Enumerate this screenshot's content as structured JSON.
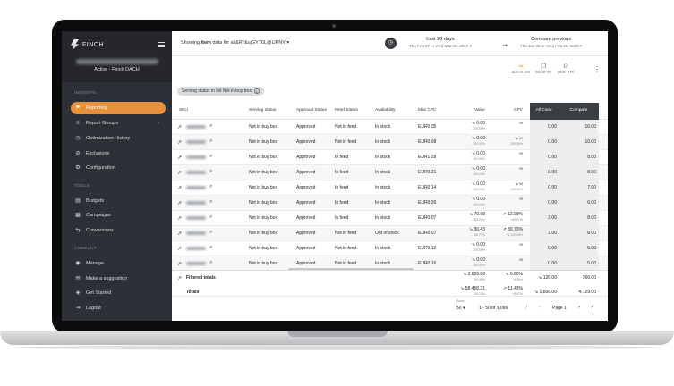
{
  "brand": {
    "name": "FINCH"
  },
  "account": {
    "name": "Active - Finch DACH"
  },
  "sidebar": {
    "sections": [
      "INSIGHTS",
      "TOOLS",
      "ACCOUNT"
    ],
    "items": [
      {
        "label": "Reporting",
        "icon": "reporting-icon",
        "glyph": "⚑",
        "active": true
      },
      {
        "label": "Report Groups",
        "icon": "report-groups-icon",
        "glyph": "≡",
        "chevron": "›"
      },
      {
        "label": "Optimization History",
        "icon": "history-icon",
        "glyph": "◷"
      },
      {
        "label": "Exclusions",
        "icon": "exclusions-icon",
        "glyph": "⊘"
      },
      {
        "label": "Configuration",
        "icon": "gear-icon",
        "glyph": "⚙"
      },
      {
        "label": "Budgets",
        "icon": "budgets-icon",
        "glyph": "▤"
      },
      {
        "label": "Campaigns",
        "icon": "campaigns-icon",
        "glyph": "▦"
      },
      {
        "label": "Conversions",
        "icon": "conversions-icon",
        "glyph": "⇆"
      },
      {
        "label": "Manage",
        "icon": "manage-icon",
        "glyph": "◉"
      },
      {
        "label": "Make a suggestion",
        "icon": "suggestion-icon",
        "glyph": "✉"
      },
      {
        "label": "Get Started",
        "icon": "get-started-icon",
        "glyph": "◈"
      },
      {
        "label": "Logout",
        "icon": "logout-icon",
        "glyph": "⇥"
      }
    ]
  },
  "topbar": {
    "showing_prefix": "Showing",
    "showing_bold": "item",
    "showing_suffix": "data for ali&R*&ujGY76L@UPNY",
    "dropdown_glyph": "▾",
    "date_range": {
      "title": "Last 28 days",
      "dates": "Thu Feb 27 to Wed Mar 25, 2020"
    },
    "compare_range": {
      "title": "Compare previous",
      "dates": "Thu Jan 30 to Wed Feb 26, 2020"
    },
    "calendar_glyph": "◷",
    "compare_glyph": "⇝"
  },
  "tools": [
    {
      "label": "ADD FILTER",
      "icon": "filter-icon",
      "glyph": "≂"
    },
    {
      "label": "GROUP BY",
      "icon": "group-by-icon",
      "glyph": "❐"
    },
    {
      "label": "VIEW TYPE",
      "icon": "view-type-icon",
      "glyph": "⊙"
    }
  ],
  "filter_chip": {
    "label": "Serving status in list Not in buy box",
    "close": "×"
  },
  "table": {
    "headers": [
      "SKU",
      "Serving status",
      "Approval Status",
      "Feed Status",
      "Availability",
      "Max CPC",
      "Value",
      "CPV",
      "All Conv.",
      "Compare"
    ],
    "rows": [
      {
        "serving": "Not in buy box",
        "approval": "Approved",
        "feed": "Not in feed",
        "avail": "In stock",
        "cpc": "EUR0.05",
        "value": "↘ 0.00",
        "value_s": "-100.00%",
        "cpv": "∞",
        "cpv_s": "",
        "conv": "0.00",
        "compare": "16.00"
      },
      {
        "serving": "Not in buy box",
        "approval": "Approved",
        "feed": "Not in feed",
        "avail": "In stock",
        "cpc": "EUR0.08",
        "value": "↘ 0.00",
        "value_s": "-100.00%",
        "cpv": "↘ ∞",
        "cpv_s": "-100.00%",
        "conv": "0.00",
        "compare": "10.00"
      },
      {
        "serving": "Not in buy box",
        "approval": "Approved",
        "feed": "In feed",
        "avail": "In stock",
        "cpc": "EUR1.28",
        "value": "↘ 0.00",
        "value_s": "-100.00%",
        "cpv": "∞",
        "cpv_s": "",
        "conv": "0.00",
        "compare": "8.00"
      },
      {
        "serving": "Not in buy box",
        "approval": "Approved",
        "feed": "In feed",
        "avail": "In stock",
        "cpc": "EUR0.21",
        "value": "↘ 0.00",
        "value_s": "-100.00%",
        "cpv": "∞",
        "cpv_s": "",
        "conv": "0.00",
        "compare": "8.00"
      },
      {
        "serving": "Not in buy box",
        "approval": "Approved",
        "feed": "In feed",
        "avail": "In stock",
        "cpc": "EUR0.14",
        "value": "↘ 0.00",
        "value_s": "-100.00%",
        "cpv": "↘ ∞",
        "cpv_s": "-100.00%",
        "conv": "0.00",
        "compare": "7.00"
      },
      {
        "serving": "Not in buy box",
        "approval": "Approved",
        "feed": "In feed",
        "avail": "In stock",
        "cpc": "EUR0.26",
        "value": "↘ 0.00",
        "value_s": "-100.00%",
        "cpv": "∞",
        "cpv_s": "",
        "conv": "0.00",
        "compare": "6.00"
      },
      {
        "serving": "Not in buy box",
        "approval": "Approved",
        "feed": "In feed",
        "avail": "In stock",
        "cpc": "EUR0.07",
        "value": "↘ 70.68",
        "value_s": "-83.22%",
        "cpv": "↗ 12.99%",
        "cpv_s": "+49.17%",
        "conv": "2.00",
        "compare": "8.00"
      },
      {
        "serving": "Not in buy box",
        "approval": "Approved",
        "feed": "Not in feed",
        "avail": "Out of stock",
        "cpc": "EUR0.07",
        "value": "↘ 30.43",
        "value_s": "-86.71%",
        "cpv": "↗ 30.73%",
        "cpv_s": "+1,120.80%",
        "conv": "2.00",
        "compare": "8.00"
      },
      {
        "serving": "Not in buy box",
        "approval": "Approved",
        "feed": "Not in feed",
        "avail": "In stock",
        "cpc": "EUR0.12",
        "value": "↘ 0.00",
        "value_s": "-100.00%",
        "cpv": "∞",
        "cpv_s": "",
        "conv": "0.00",
        "compare": "5.00"
      },
      {
        "serving": "Not in buy box",
        "approval": "Approved",
        "feed": "Not in feed",
        "avail": "In stock",
        "cpc": "EUR0.16",
        "value": "↘ 0.00",
        "value_s": "-100.00%",
        "cpv": "∞",
        "cpv_s": "",
        "conv": "0.00",
        "compare": "5.00"
      }
    ],
    "filtered_totals": {
      "label": "Filtered totals",
      "value": "↘ 3,609.88",
      "value_s": "-69.48%",
      "cpv": "↘ 9.80%",
      "cpv_s": "-5.06%",
      "conv": "↘ 126.00",
      "compare": "366.00"
    },
    "totals": {
      "label": "Totals",
      "value": "↘ 58,458.21",
      "value_s": "-26.13%",
      "cpv": "↗ 11.43%",
      "cpv_s": "+8.97%",
      "conv": "↘ 1,856.00",
      "compare": "4,129.00"
    }
  },
  "pagination": {
    "rows_label": "Rows",
    "rows_value": "50 ▾",
    "range": "1 - 50 of 1,096",
    "page": "Page 1",
    "first": "|‹",
    "prev": "‹",
    "next": "›",
    "last": "›|"
  },
  "colors": {
    "accent": "#e8913a",
    "sidebar": "#2d3036",
    "dark_header": "#3a3d42"
  }
}
